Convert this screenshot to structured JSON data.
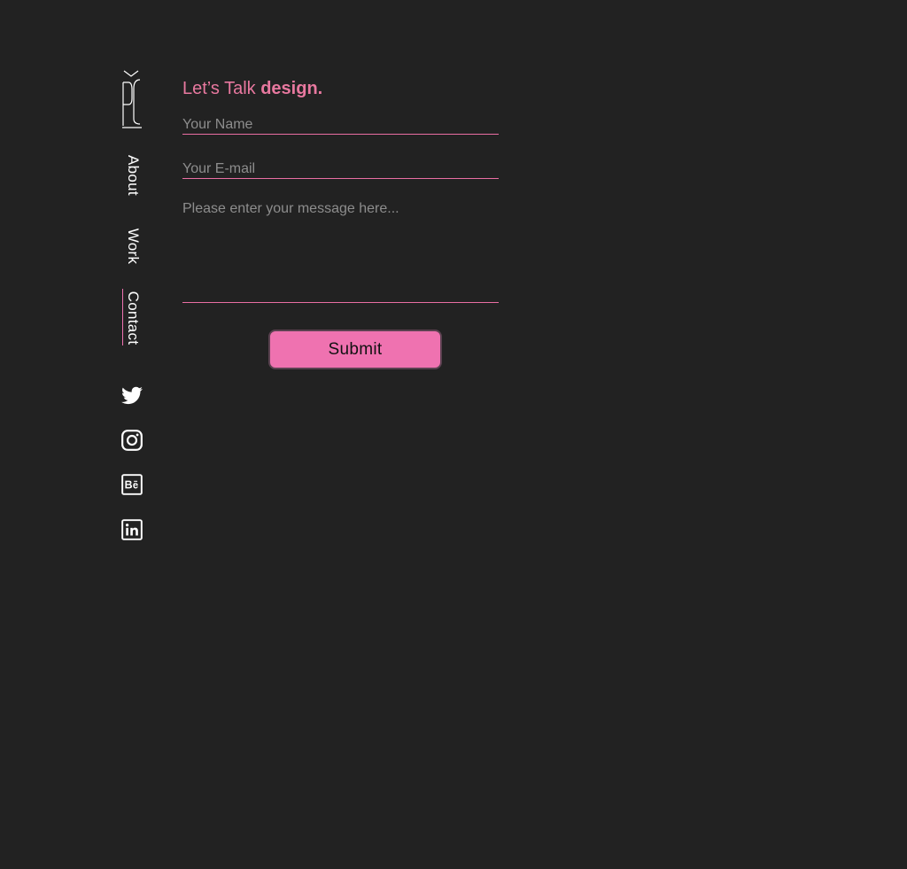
{
  "brand": {
    "logo_icon": "pc-monogram-icon"
  },
  "nav": {
    "items": [
      {
        "label": "About"
      },
      {
        "label": "Work"
      },
      {
        "label": "Contact",
        "active": true
      }
    ]
  },
  "social": [
    {
      "icon": "twitter-icon"
    },
    {
      "icon": "instagram-icon"
    },
    {
      "icon": "behance-icon"
    },
    {
      "icon": "linkedin-icon"
    }
  ],
  "form": {
    "heading_light": "Let’s Talk",
    "heading_bold": "design.",
    "name_placeholder": "Your Name",
    "email_placeholder": "Your E-mail",
    "message_placeholder": "Please enter your message here...",
    "name_value": "",
    "email_value": "",
    "message_value": "",
    "submit_label": "Submit"
  },
  "colors": {
    "background": "#222222",
    "accent": "#ef72b0",
    "heading": "#e8789f",
    "text": "#ffffff"
  }
}
